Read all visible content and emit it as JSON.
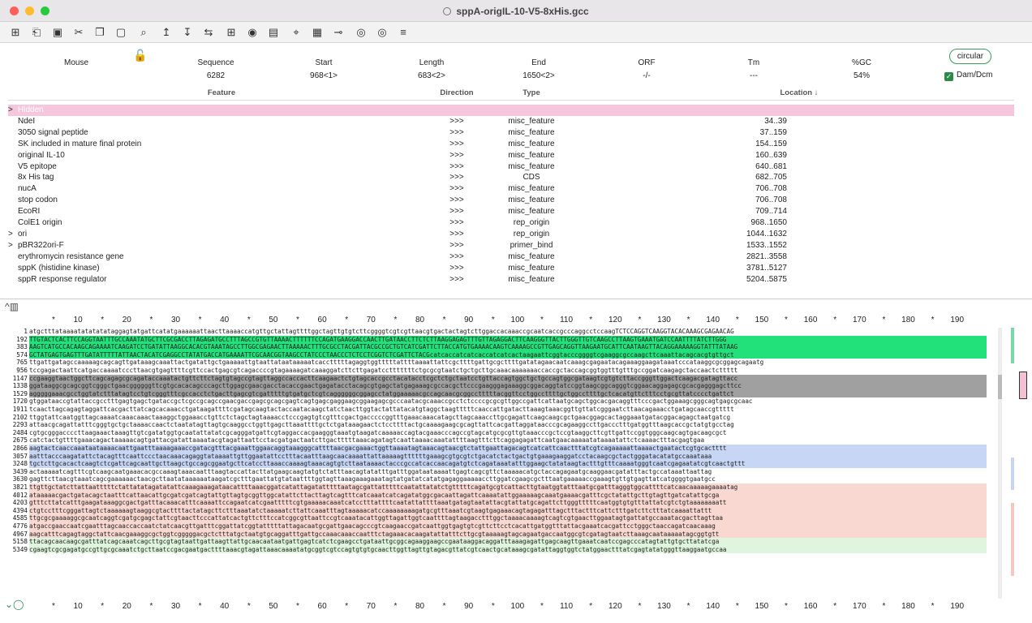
{
  "window": {
    "title": "sppA-origIL-10-V5-8xHis.gcc"
  },
  "toolbar": {
    "icons": [
      "new-file-icon",
      "open-icon",
      "save-icon",
      "cut-icon",
      "copy-icon",
      "paste-icon",
      "search-icon",
      "arrow-up-icon",
      "arrow-down-icon",
      "swap-icon",
      "grid-icon",
      "target-icon",
      "map-icon",
      "tag-icon",
      "panel-icon",
      "primer-icon",
      "circle-a-icon",
      "circle-b-icon",
      "menu-icon"
    ]
  },
  "stats": {
    "organism": "Mouse",
    "headers": {
      "sequence": "Sequence",
      "start": "Start",
      "length": "Length",
      "end": "End",
      "orf": "ORF",
      "tm": "Tm",
      "gc": "%GC"
    },
    "values": {
      "sequence": "6282",
      "start": "968<1>",
      "length": "683<2>",
      "end": "1650<2>",
      "orf": "-/-",
      "tm": "---",
      "gc": "54%"
    },
    "circular_label": "circular",
    "dam_label": "Dam/Dcm"
  },
  "table": {
    "headers": {
      "feature": "Feature",
      "direction": "Direction",
      "type": "Type",
      "location": "Location ↓"
    },
    "rows": [
      {
        "feature": "Hidden",
        "direction": "",
        "type": "",
        "location": "",
        "hidden": true,
        "caret": ">"
      },
      {
        "feature": "NdeI",
        "direction": ">>>",
        "type": "misc_feature",
        "location": "34..39"
      },
      {
        "feature": "3050 signal peptide",
        "direction": ">>>",
        "type": "misc_feature",
        "location": "37..159"
      },
      {
        "feature": "SK included in mature final protein",
        "direction": ">>>",
        "type": "misc_feature",
        "location": "154..159"
      },
      {
        "feature": "original IL-10",
        "direction": ">>>",
        "type": "misc_feature",
        "location": "160..639"
      },
      {
        "feature": "V5 epitope",
        "direction": ">>>",
        "type": "misc_feature",
        "location": "640..681"
      },
      {
        "feature": "8x His tag",
        "direction": ">>>",
        "type": "CDS",
        "location": "682..705"
      },
      {
        "feature": "nucA",
        "direction": ">>>",
        "type": "misc_feature",
        "location": "706..708"
      },
      {
        "feature": "stop codon",
        "direction": ">>>",
        "type": "misc_feature",
        "location": "706..708"
      },
      {
        "feature": "EcoRI",
        "direction": ">>>",
        "type": "misc_feature",
        "location": "709..714"
      },
      {
        "feature": "ColE1 origin",
        "direction": ">>>",
        "type": "rep_origin",
        "location": "968..1650"
      },
      {
        "feature": "ori",
        "direction": ">>>",
        "type": "rep_origin",
        "location": "1044..1632",
        "caret": ">"
      },
      {
        "feature": "pBR322ori-F",
        "direction": ">>>",
        "type": "primer_bind",
        "location": "1533..1552",
        "caret": ">"
      },
      {
        "feature": "erythromycin resistance gene",
        "direction": ">>>",
        "type": "misc_feature",
        "location": "2821..3558"
      },
      {
        "feature": "sppK (histidine kinase)",
        "direction": ">>>",
        "type": "misc_feature",
        "location": "3781..5127"
      },
      {
        "feature": "sppR response regulator",
        "direction": ">>>",
        "type": "misc_feature",
        "location": "5204..5875"
      }
    ]
  },
  "ruler": {
    "ticks": [
      "*",
      "10",
      "*",
      "20",
      "*",
      "30",
      "*",
      "40",
      "*",
      "50",
      "*",
      "60",
      "*",
      "70",
      "*",
      "80",
      "*",
      "90",
      "*",
      "100",
      "*",
      "110",
      "*",
      "120",
      "*",
      "130",
      "*",
      "140",
      "*",
      "150",
      "*",
      "160",
      "*",
      "170",
      "*",
      "180",
      "*",
      "190"
    ]
  },
  "sequence": {
    "lines": [
      {
        "n": "1",
        "t": "atgctttataaaatatatatataggagtatgattcatatgaaaaaattaacttaaaaccatgttgctattagttttggctagttgtgtcttcggggtcgtcgttaacgtgactactagtcttggaccacaaaccgcaatcaccgcccaggcctccaagTCTCCAGGTCAAGGTACACAAAGCGAGAACAG",
        "bg": "#ffffff"
      },
      {
        "n": "192",
        "t": "TTGTACTCACTTCCAGGTAATTTGCCAAATATGCTTCGCGACCTTAGAGATGCCTTTAGCCGTGTTAAAACTTTTTTCCAGATGAAGGACCAACTTGATAACCTTCTCTTAAGGAGAGTTTGTTAGAGGACTTCAAGGGTTACTTGGGTTGTCAAGCCTTAAGTGAAATGATCCAATTTTATCTTGGG",
        "bg": "#22e07a"
      },
      {
        "n": "383",
        "t": "AAGTCATGCCACAAGCAGAAAATCAAGATCCTGATATTAAGGCACACGTAAATAGCCTTGGCGAGAACTTAAAAACTTTGCGCCTACGATTACGCCGCTGTCATCGATTCTTACCATGTGAAAACAAGTCAAAAGCCGTTGAGCAGGTTAAGAATGCATTCAATAAGTTACAGGAAAAAGGTATTTATAAG",
        "bg": "#22e07a"
      },
      {
        "n": "574",
        "t": "GCTATGAGTGAGTTTGATATTTTTATTAACTACATCGAGGCCTATATGACCATGAAAATTCGCAACGGTAAGCCTATCCCTAACCCTCTCCTCGGTCTCGATTCTACGcatcaccatcatcaccatcatcactaagaattcggtacccggggtcgaaggcgccaagcttcaaattacagcacgtgttgct",
        "bg": "#22e07a"
      },
      {
        "n": "765",
        "t": "ttgattgatagccaaaaagcagcagttgataaagcaaattactgatattgctgaaaaattgtaattataataaaaatcacctttttagaggtggtttttattttaaaattattcgcttttgattgcgcttttgatatagaacaatcaaagcgagaatacagaaaggaagataaatcccataaggcgcggagcagaatg",
        "bg": "#ffffff"
      },
      {
        "n": "956",
        "t": "tccgagactaattcatgaccaaaatcccttaacgtgagttttcgttccactgagcgtcagaccccgtagaaaagatcaaaggatcttcttgagatcctttttttctgcgcgtaatctgctgcttgcaaacaaaaaaaccaccgctaccagcggtggtttgtttgccggatcaagagctaccaactcttttt",
        "bg": "#ffffff"
      },
      {
        "n": "1147",
        "t": "ccgaaggtaactggcttcagcagagcgcagataccaaatactgttcttctagtgtagccgtagttaggccaccacttcaagaactctgtagcaccgcctacatacctcgctctgctaatcctgttaccagtggctgctgccagtggcgataagtcgtgtcttaccgggttggactcaagacgatagttacc",
        "bg": "#a0a0a0"
      },
      {
        "n": "1338",
        "t": "ggataaggcgcagcggtcgggctgaacggggggttcgtgcacacagcccagcttggagcgaacgacctacaccgaactgagatacctacagcgtgagctatgagaaagcgccacgcttcccgaagggagaaaggcggacaggtatccggtaagcggcagggtcggaacaggagagcgcacgagggagcttcc",
        "bg": "#a0a0a0"
      },
      {
        "n": "1529",
        "t": "agggggaaacgcctggtatctttatagtcctgtcgggtttcgccacctctgacttgagcgtcgatttttgtgatgctcgtcaggggggcggagcctatggaaaaacgccagcaacgcggcctttttacggttcctggccttttgctggccttttgctcacatgttctttcctgcgttatcccctgattct",
        "bg": "#a0a0a0"
      },
      {
        "n": "1720",
        "t": "gtggataaccgtattaccgcctttgagtgagctgataccgctcgccgcagccgaacgaccgagcgcagcgagtcagtgagcgaggaagcggaagagcgcccaatacgcaaaccgcctctccccgcgcgttggccgattcattaatgcagctggcacgacaggtttcccgactggaaagcgggcagtgagcgcaac",
        "bg": "#ffffff"
      },
      {
        "n": "1911",
        "t": "tcaacttagcagagtaggattcacgacttatcagcacaaacctgataagattttcgatagcaagtactaccaatacaagctatctaacttggtactattatacatgtaggctaagtttttcaaccattgatacttaaagtaaacggttgttatcgggaatcttaacagaaacctgatagcaaccgttttt",
        "bg": "#ffffff"
      },
      {
        "n": "2102",
        "t": "ttggtattcaatggttagcaaaatcaaacaaactaaaggctggaaacctgttctctagctagtaaaacctcccgagtgtcgtttcgactgacccccggtttgaaacaaacatagcttagcaaaccttgcgagattcaagcaagcgctgaacggagcactaggaaatgatacggacagagctaatgatcg",
        "bg": "#ffffff"
      },
      {
        "n": "2293",
        "t": "attaacgcagattatttcgggtgctgctaaaaccaactctaatatagttagtgcaaggcctggttgagcttaaattttgctctgataaagaactctccttttactgcaaaagaagcgcagttattcacgattaggataacccgcagaaggccttgaccctttgatggtttaagcaccgctatgtgcctag",
        "bg": "#ffffff"
      },
      {
        "n": "2484",
        "t": "cgtgcgggaccccttaagaaactaaagttgtcgatatggtgcaatattatatcgcagggatgattcgtaggaccacgaagggtaaatgtaagatcaaaaaccagtacgaaacccagccgtagcatgcgcgttgtaaacccgctccgtaaggcttcgttgattccggtgggcaagcagtgacaagcgct",
        "bg": "#ffffff"
      },
      {
        "n": "2675",
        "t": "catctactgttttgaaacagactaaaaacagtgattacgatattaaaatacgtagattaattcctacgatgactaatcttgactttttaaacagatagtcaattaaaacaaatattttaagtttcttcaggagagattcaatgaacaaaaatataaaatattctcaaaactttacgagtgaa",
        "bg": "#ffffff"
      },
      {
        "n": "2866",
        "t": "aagtactcaaccaaataataaaacaattgaatttaaaagaaaccgatacgtttacgaaattggaacaggtaaagggcattttaacgacgaaactggttaaaatagtaaacagtaacgtctattgaattagacagtcatcattcaactttatcgtcagaaaaattaaaactgaatactcgtgcactttt",
        "bg": "#c7d6f5"
      },
      {
        "n": "3057",
        "t": "aatttacccaagatattctacagtttcaattccctaacaaacagaggtataaaattgttggaatattcctttacaatttaagcaacaaaattattaaaaagttttttgaaagcgtgcgtctgacatctactgactgtgaaagaaggatcctacaagcgctactgggatacatatgccaaataaa",
        "bg": "#c7d6f5"
      },
      {
        "n": "3248",
        "t": "tgctcttgcacactcaagtctcgattcagcaattgcttaagctgccagcggaatgcttcatccttaaaccaaaagtaaacagtgtcttaataaaactacccgccatcaccaacagatgtctcagataaatatttggaagctatataagtactttgtttcaaaatgggtcaatcgagaatatcgtcaactgttt",
        "bg": "#c7d6f5"
      },
      {
        "n": "3439",
        "t": "actaaaaatcagtttcgtcaagcaatgaaacacgccaaagtaaacaatttaagtaccattacttatgaagcaagtatgtctatttaacagtatatttgatttggataataaaattgagtcagcgttctaaaaacatgctaccagagaatgcaaggaacgatatttactgccataaattaattag",
        "bg": "#ffffff"
      },
      {
        "n": "3630",
        "t": "gagttcttaacgtaaatcagcgaaaaaactaacgcttaatataaaaaataagatcgctttgaattatgtataattttggtagttaaagaaagaaatagtatgatatcatatgagaggaaaaaccttggatcgaagcgctttaatgaaaaaccgaaagtgttgtgagttatcatggggtgaatgcc",
        "bg": "#ffffff"
      },
      {
        "n": "3821",
        "t": "ttgttgctatcttattaatttttctattatatagatatattcaaagaaagataacattttaaacggatcatattagatatttttaatagcgattatttttcaatattatatctgtttttcagatgcgtcattacttgtaatggtatttaatgcgatttagggtggcattttcatcaacaaaaagaaaatag",
        "bg": "#f8d8d0"
      },
      {
        "n": "4012",
        "t": "ataaaaacgactgatacagctaatttcattaacattgcgatcgatcagtattgttagtgcggttggcatattcttacttagtcagtttcatcaaatcatcagatatggcgacaattagattcaaaatattggaaaaagcaaatgaaaacgatttcgctatattgcttgtagttgatcatattgcga",
        "bg": "#f8d8d0"
      },
      {
        "n": "4203",
        "t": "gtttcttatcatttgaagataaaggcgactgatttacaaacatttcaaaattccagaatcatcgaatttttcgtgaaaaacaaatcatcctttattttcaatattattttaaatgatagtaatattacgtattatgcagattcttgggtttttcaatggtgtgtttattatcgtctgtaaaaaaaatt",
        "bg": "#f8d8d0"
      },
      {
        "n": "4394",
        "t": "ctgtcctttcgggattagtctaaaaaagtaaggcgtacttttactatagcttctttaaatatctaaaaatcttattcaaatttagtaaaaacatccaaaaaaaagatgcgtttaaatcgtaagtgagaaacagtagagatttagctttactttcattctttgatcttctttatcaaaattattt",
        "bg": "#f8d8d0"
      },
      {
        "n": "4585",
        "t": "ttgcgcgaaaaggcgcaatcaggtcgatgcgagctattcgtaacttcccattatcactgttctttccatcggcgttaattccgtcaaatacattggttagattggtcaattttagtaagacctttggctaaaacaaaagtcagtcgtgaacttggaatagtgattatgccaaatacgacttagttaa",
        "bg": "#f8d8d0"
      },
      {
        "n": "4776",
        "t": "atgaccgaaccaatcgaatttagcaaccaccaatctatcaacgttgatttcggattatcggtatttttattagacaatgcgattgaacagcccgtcaagaaccgatcaattggtgagtgtcgttcttcctcacattgatggtttattacgaaatcacgattcctgggctaaccagatcaacaaag",
        "bg": "#f8d8d0"
      },
      {
        "n": "4967",
        "t": "aagcatttcagagtaggctattcaacgaaaggcgctggtcgggggacgctctttatgctaatgtgcaggatttgattgccaaacaaaccaatttctagaaacacaagatattatttcttgcgtaaaaagtagcagaatgaccaatggcgtcgatagtaatcttaaagcaataaaaatagcggtgtt",
        "bg": "#f8d8d0"
      },
      {
        "n": "5158",
        "t": "ttacagcaacaagcgatttatcagcaaatcagcttgcgtagtaattgattaagttattgcaacaataatgattgagtcatctcgaagcctgataattgcggcagaaggaagccgaataaggacaggatttaaagagattgagcaagttgaaatcaatccgagcccatagtattgtgcttatatcga",
        "bg": "#e0f5dd"
      },
      {
        "n": "5349",
        "t": "cgaagtcgcgagatgccgttgcgcaaatctgcttaatccgacgaatgacttttaaacgtagattaaacaaaatatgcggtcgtccagtgtgtgcaacttggttagttgtagacgttatcgtcaactgcataaagcgatattaggtggtctatggaactttatcgagtatatgggttaaggaatgccaa",
        "bg": "#e0f5dd"
      }
    ]
  }
}
